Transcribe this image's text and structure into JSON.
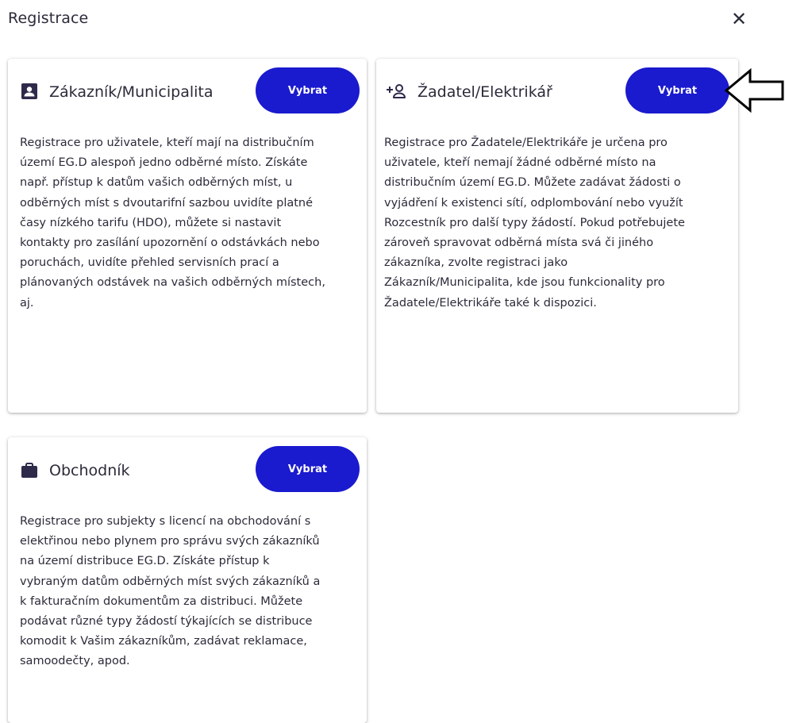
{
  "dialog": {
    "title": "Registrace",
    "close_label": "✕"
  },
  "cards": [
    {
      "title": "Zákazník/Municipalita",
      "icon": "contact-card-icon",
      "button_label": "Vybrat",
      "description_lines": [
        "Registrace pro uživatele, kteří mají na distribučním",
        "území EG.D alespoň jedno odběrné místo. Získáte",
        "např. přístup k datům vašich odběrných míst, u",
        "odběrných míst s dvoutarifní sazbou uvidíte platné",
        "časy nízkého tarifu (HDO), můžete si nastavit",
        "kontakty pro zasílání upozornění o odstávkách nebo",
        "poruchách, uvidíte přehled servisních prací a",
        "plánovaných odstávek na vašich odběrných místech,",
        "aj."
      ]
    },
    {
      "title": "Žadatel/Elektrikář",
      "icon": "person-add-icon",
      "button_label": "Vybrat",
      "description_lines": [
        "Registrace pro Žadatele/Elektrikáře je určena pro",
        "uživatele, kteří nemají žádné odběrné místo na",
        "distribučním území EG.D. Můžete zadávat žádosti o",
        "vyjádření k existenci sítí, odplombování nebo využít",
        "Rozcestník pro další typy žádostí. Pokud potřebujete",
        "zároveň spravovat odběrná místa svá či jiného",
        "zákazníka, zvolte registraci jako",
        "Zákazník/Municipalita, kde jsou funkcionality pro",
        "Žadatele/Elektrikáře také k dispozici."
      ]
    },
    {
      "title": "Obchodník",
      "icon": "briefcase-icon",
      "button_label": "Vybrat",
      "description_lines": [
        "Registrace pro subjekty s licencí na obchodování s",
        "elektřinou nebo plynem pro správu svých zákazníků",
        "na území distribuce EG.D. Získáte přístup k",
        "vybraným datům odběrných míst svých zákazníků a",
        "k fakturačním dokumentům za distribuci. Můžete",
        "podávat různé typy žádostí týkajících se distribuce",
        "komodit k Vašim zákazníkům, zadávat reklamace,",
        "samoodečty, apod."
      ]
    }
  ],
  "colors": {
    "button_bg": "#1a1acf",
    "button_text": "#ffffff",
    "text": "#2b2b3a",
    "icon": "#2e2a4a"
  }
}
